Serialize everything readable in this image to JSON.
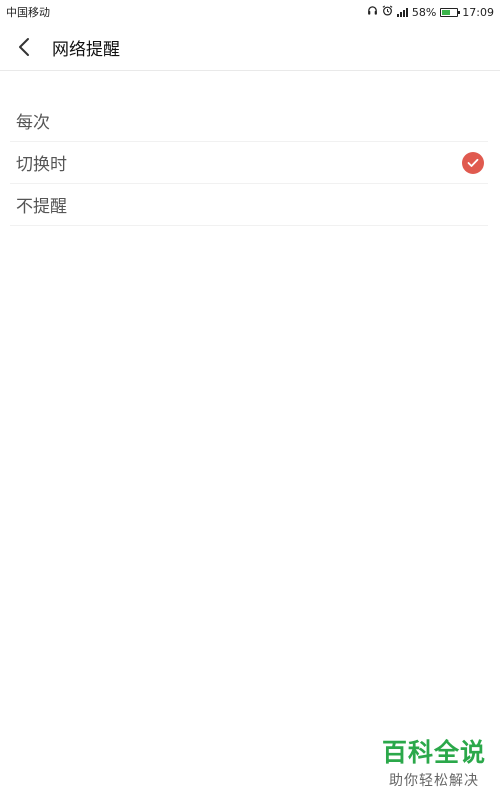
{
  "status_bar": {
    "carrier": "中国移动",
    "battery_percent": "58%",
    "battery_level": 0.58,
    "time": "17:09",
    "icons": [
      "headset-icon",
      "alarm-icon",
      "signal-icon",
      "battery-icon"
    ]
  },
  "header": {
    "back_icon": "chevron-left-icon",
    "title": "网络提醒"
  },
  "options": [
    {
      "label": "每次",
      "selected": false
    },
    {
      "label": "切换时",
      "selected": true
    },
    {
      "label": "不提醒",
      "selected": false
    }
  ],
  "watermark": {
    "title": "百科全说",
    "subtitle": "助你轻松解决"
  },
  "colors": {
    "check": "#e05a4f",
    "watermark_green": "#2ba84a",
    "battery_green": "#3bb54a"
  }
}
